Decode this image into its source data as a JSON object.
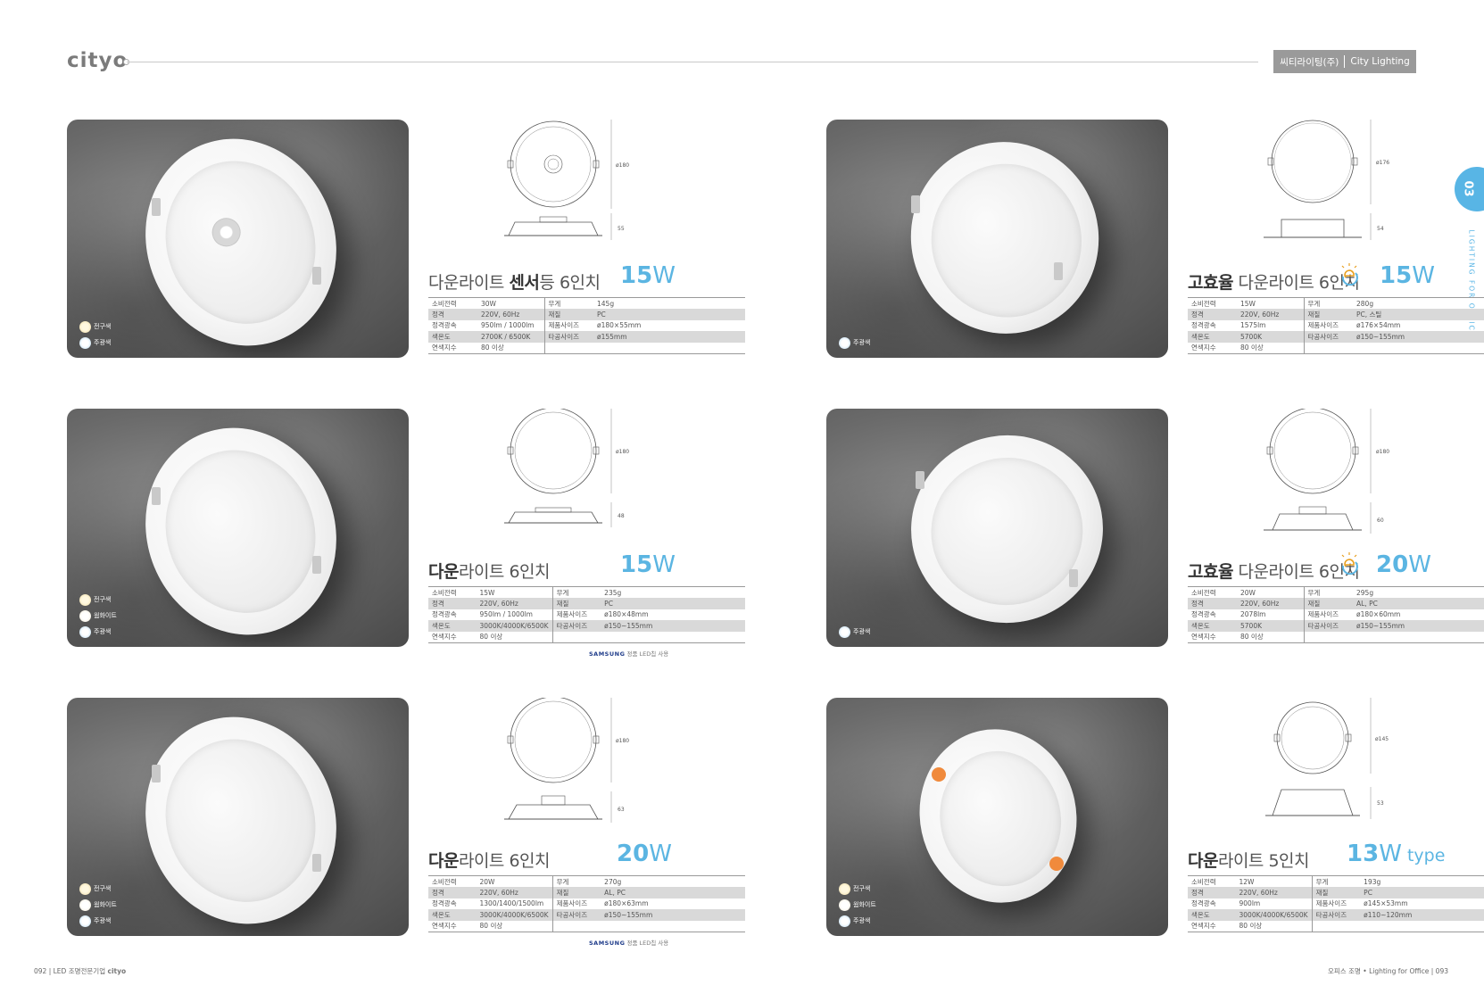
{
  "header": {
    "brand": "cityo",
    "badge_left": "씨티라이팅(주)",
    "badge_right": "City Lighting"
  },
  "side": {
    "tab": "03",
    "label": "LIGHTING FOR OFFICE"
  },
  "spec_labels": {
    "power": "소비전력",
    "rating": "정격",
    "flux": "정격광속",
    "cct": "색온도",
    "cri": "연색지수",
    "weight": "무게",
    "material": "재질",
    "size": "제품사이즈",
    "hole": "타공사이즈"
  },
  "colors": {
    "warm": "전구색",
    "white": "웜화이트",
    "day": "주광색"
  },
  "products": [
    {
      "title_pre": "다운라이트 ",
      "title_bold": "센서",
      "title_post": "등 6인치",
      "watt": "15",
      "watt_unit": "W",
      "watt_type": "",
      "dims": {
        "dia": "ø180",
        "h": "55"
      },
      "specs": {
        "power": "30W",
        "rating": "220V, 60Hz",
        "flux": "950lm / 1000lm",
        "cct": "2700K / 6500K",
        "cri": "80 이상",
        "weight": "145g",
        "material": "PC",
        "size": "ø180×55mm",
        "hole": "ø155mm"
      },
      "samsung": ""
    },
    {
      "title_pre": "",
      "title_bold": "고효율",
      "title_post": " 다운라이트 6인치",
      "watt": "15",
      "watt_unit": "W",
      "watt_type": "",
      "dims": {
        "dia": "ø176",
        "h": "54"
      },
      "specs": {
        "power": "15W",
        "rating": "220V, 60Hz",
        "flux": "1575lm",
        "cct": "5700K",
        "cri": "80 이상",
        "weight": "280g",
        "material": "PC, 스틸",
        "size": "ø176×54mm",
        "hole": "ø150~155mm"
      },
      "samsung": ""
    },
    {
      "title_pre": "",
      "title_bold": "다운",
      "title_post": "라이트 6인치",
      "watt": "15",
      "watt_unit": "W",
      "watt_type": "",
      "dims": {
        "dia": "ø180",
        "h": "48"
      },
      "specs": {
        "power": "15W",
        "rating": "220V, 60Hz",
        "flux": "950lm / 1000lm",
        "cct": "3000K/4000K/6500K",
        "cri": "80 이상",
        "weight": "235g",
        "material": "PC",
        "size": "ø180×48mm",
        "hole": "ø150~155mm"
      },
      "samsung": "정품 LED칩 사용"
    },
    {
      "title_pre": "",
      "title_bold": "고효율",
      "title_post": " 다운라이트 6인치",
      "watt": "20",
      "watt_unit": "W",
      "watt_type": "",
      "dims": {
        "dia": "ø180",
        "h": "60"
      },
      "specs": {
        "power": "20W",
        "rating": "220V, 60Hz",
        "flux": "2078lm",
        "cct": "5700K",
        "cri": "80 이상",
        "weight": "295g",
        "material": "AL, PC",
        "size": "ø180×60mm",
        "hole": "ø150~155mm"
      },
      "samsung": ""
    },
    {
      "title_pre": "",
      "title_bold": "다운",
      "title_post": "라이트 6인치",
      "watt": "20",
      "watt_unit": "W",
      "watt_type": "",
      "dims": {
        "dia": "ø180",
        "h": "63"
      },
      "specs": {
        "power": "20W",
        "rating": "220V, 60Hz",
        "flux": "1300/1400/1500lm",
        "cct": "3000K/4000K/6500K",
        "cri": "80 이상",
        "weight": "270g",
        "material": "AL, PC",
        "size": "ø180×63mm",
        "hole": "ø150~155mm"
      },
      "samsung": "정품 LED칩 사용"
    },
    {
      "title_pre": "",
      "title_bold": "다운",
      "title_post": "라이트 5인치",
      "watt": "13",
      "watt_unit": "W",
      "watt_type": " type",
      "dims": {
        "dia": "ø145",
        "h": "53"
      },
      "specs": {
        "power": "12W",
        "rating": "220V, 60Hz",
        "flux": "900lm",
        "cct": "3000K/4000K/6500K",
        "cri": "80 이상",
        "weight": "193g",
        "material": "PC",
        "size": "ø145×53mm",
        "hole": "ø110~120mm"
      },
      "samsung": ""
    }
  ],
  "samsung_brand": "SAMSUNG",
  "footer": {
    "left_page": "092",
    "left_text": "LED 조명전문기업",
    "left_brand": "cityo",
    "right_text": "오피스 조명 • Lighting for Office",
    "right_page": "093"
  },
  "accent_color": "#5bb5e2"
}
